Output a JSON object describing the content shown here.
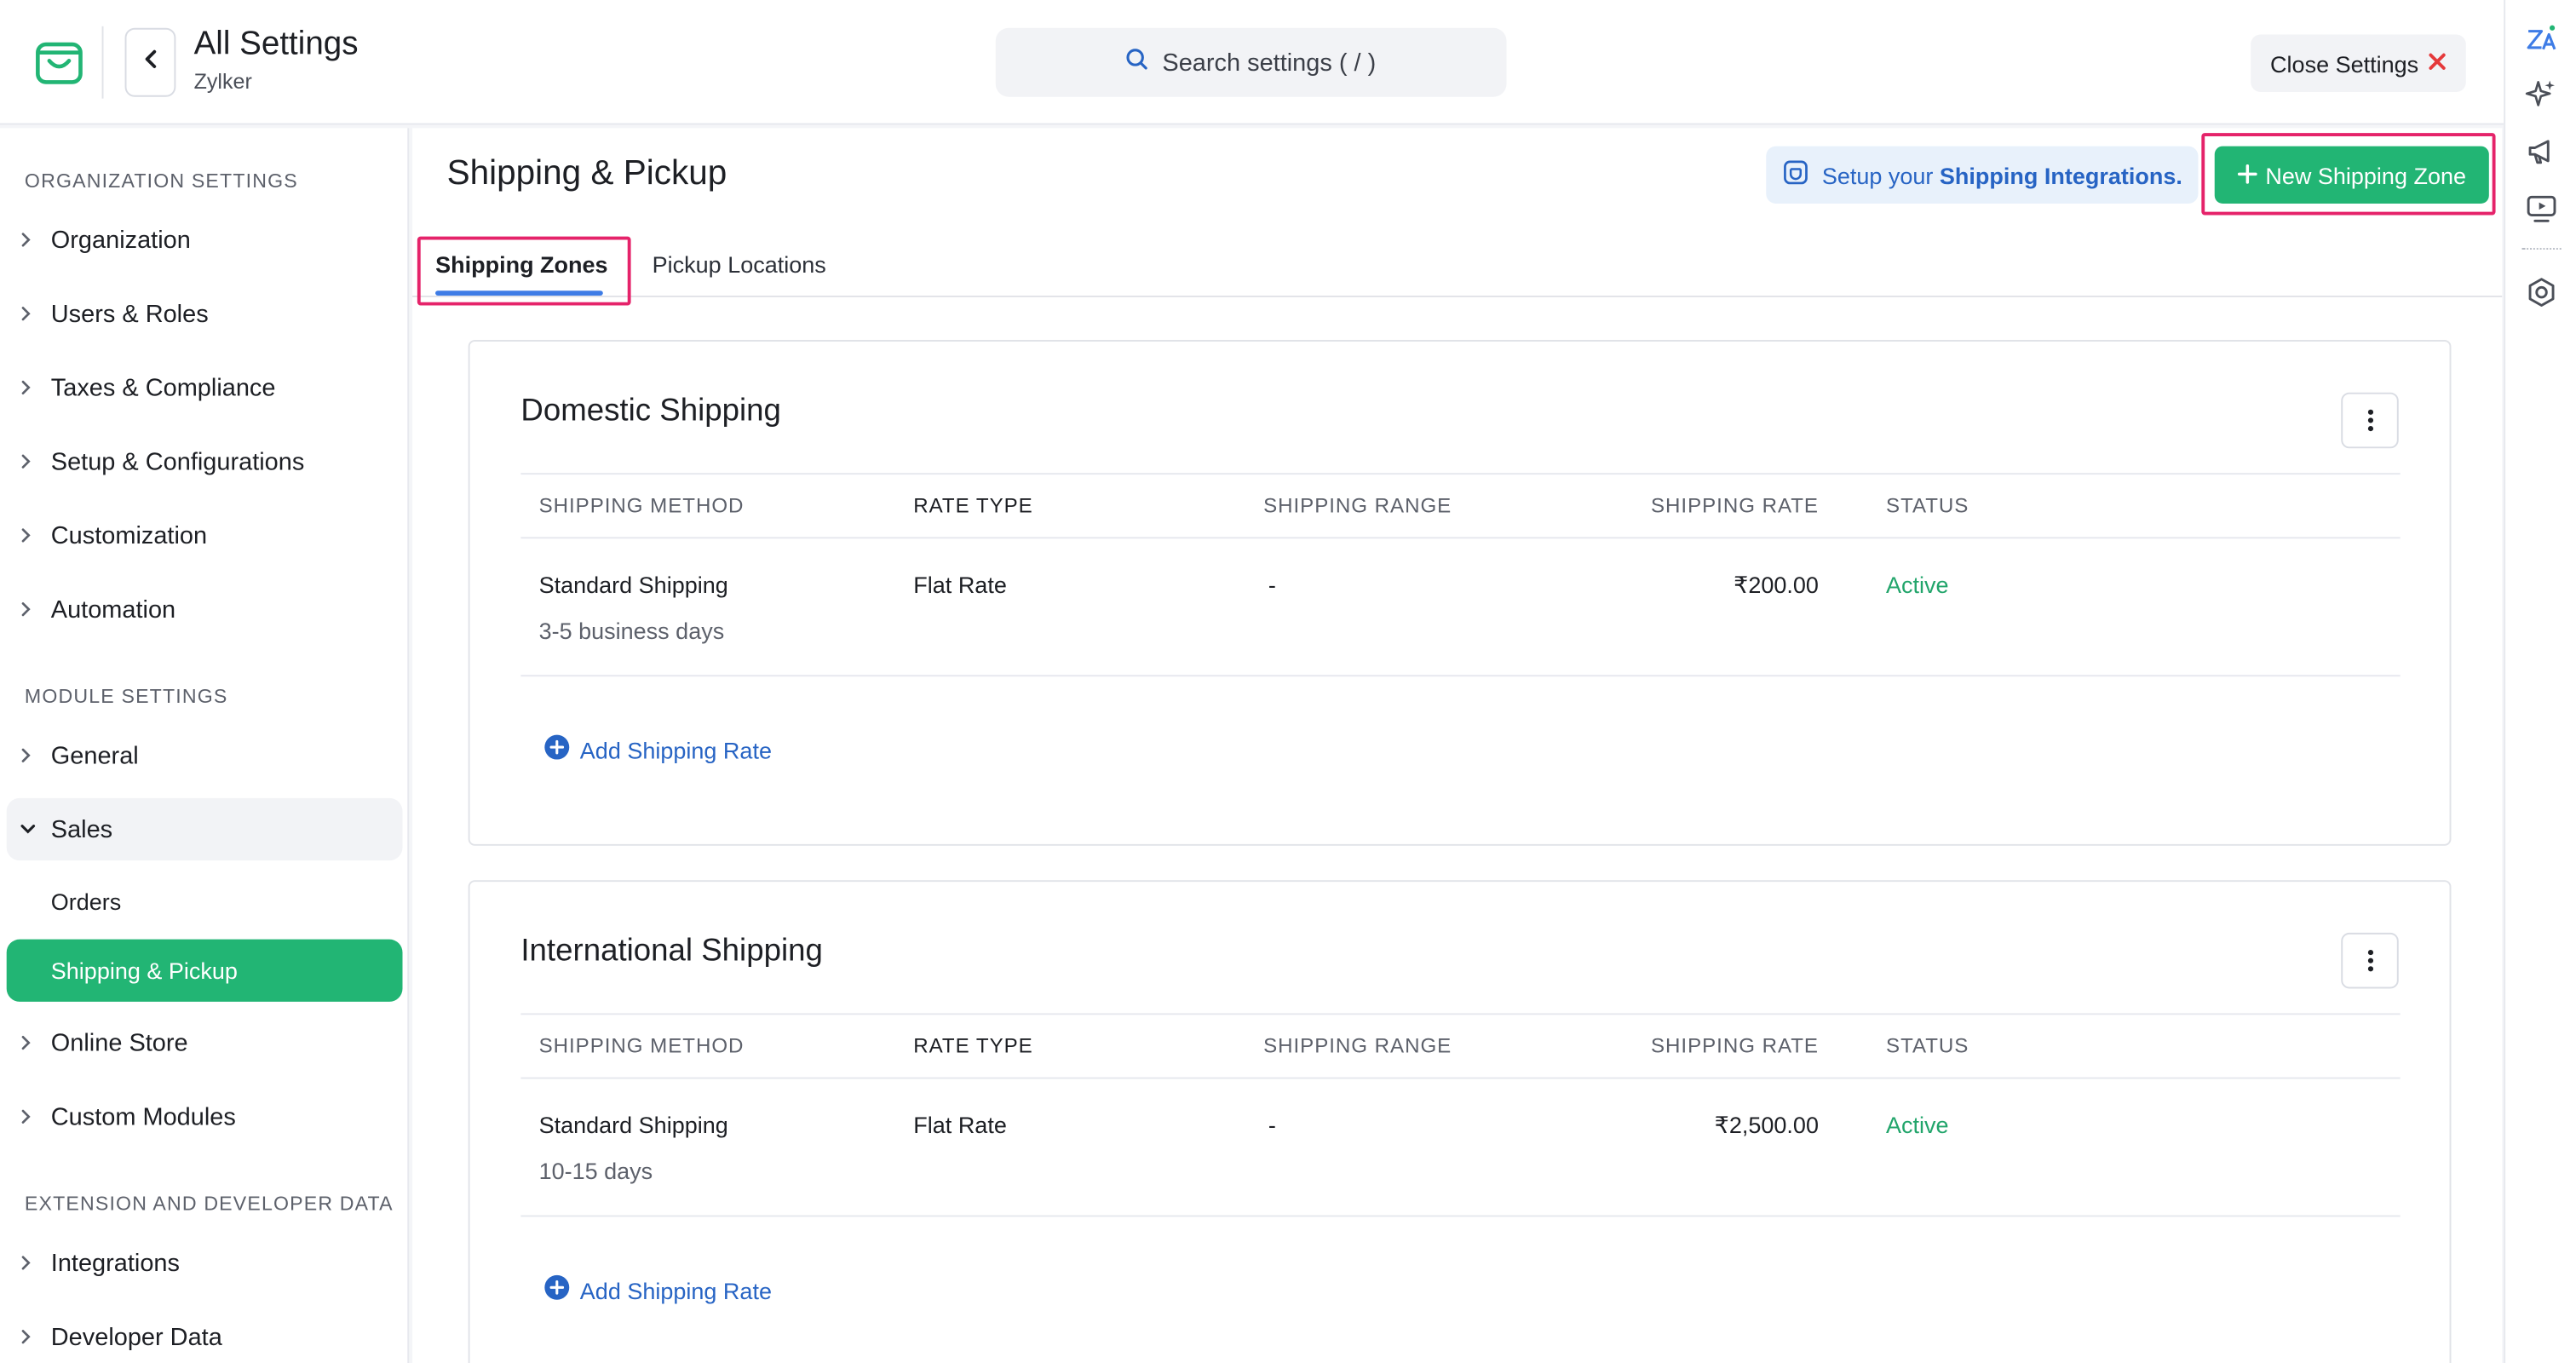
{
  "header": {
    "title": "All Settings",
    "org": "Zylker",
    "search_placeholder": "Search settings ( / )",
    "close_label": "Close Settings"
  },
  "sidebar": {
    "sections": [
      {
        "title": "ORGANIZATION SETTINGS",
        "items": [
          "Organization",
          "Users & Roles",
          "Taxes & Compliance",
          "Setup & Configurations",
          "Customization",
          "Automation"
        ]
      },
      {
        "title": "MODULE SETTINGS",
        "items": [
          "General",
          "Sales",
          "Orders",
          "Shipping & Pickup",
          "Online Store",
          "Custom Modules"
        ]
      },
      {
        "title": "EXTENSION AND DEVELOPER DATA",
        "items": [
          "Integrations",
          "Developer Data"
        ]
      }
    ],
    "active_item": "Shipping & Pickup",
    "expanded_item": "Sales"
  },
  "page": {
    "title": "Shipping & Pickup",
    "banner_prefix": "Setup your",
    "banner_link": "Shipping Integrations.",
    "new_zone_label": "New Shipping Zone",
    "tabs": [
      "Shipping Zones",
      "Pickup Locations"
    ],
    "active_tab": "Shipping Zones"
  },
  "columns": [
    "SHIPPING METHOD",
    "RATE TYPE",
    "SHIPPING RANGE",
    "SHIPPING RATE",
    "STATUS"
  ],
  "zones": [
    {
      "name": "Domestic Shipping",
      "rows": [
        {
          "method": "Standard Shipping",
          "duration": "3-5 business days",
          "rate_type": "Flat Rate",
          "range": "-",
          "rate": "₹200.00",
          "status": "Active"
        }
      ],
      "add_label": "Add Shipping Rate"
    },
    {
      "name": "International Shipping",
      "rows": [
        {
          "method": "Standard Shipping",
          "duration": "10-15 days",
          "rate_type": "Flat Rate",
          "range": "-",
          "rate": "₹2,500.00",
          "status": "Active"
        }
      ],
      "add_label": "Add Shipping Rate"
    }
  ],
  "colors": {
    "brand_green": "#22b574",
    "link_blue": "#2764c4",
    "highlight": "#e5236a",
    "status_active": "#22a56b"
  },
  "icons": {
    "logo": "shopping-bag-icon",
    "back": "chevron-left-icon",
    "search": "search-icon",
    "close": "close-icon",
    "rail": [
      "translate-icon",
      "sparkle-icon",
      "megaphone-icon",
      "video-help-icon",
      "support-icon"
    ],
    "kebab": "kebab-menu-icon",
    "add": "plus-circle-icon"
  }
}
